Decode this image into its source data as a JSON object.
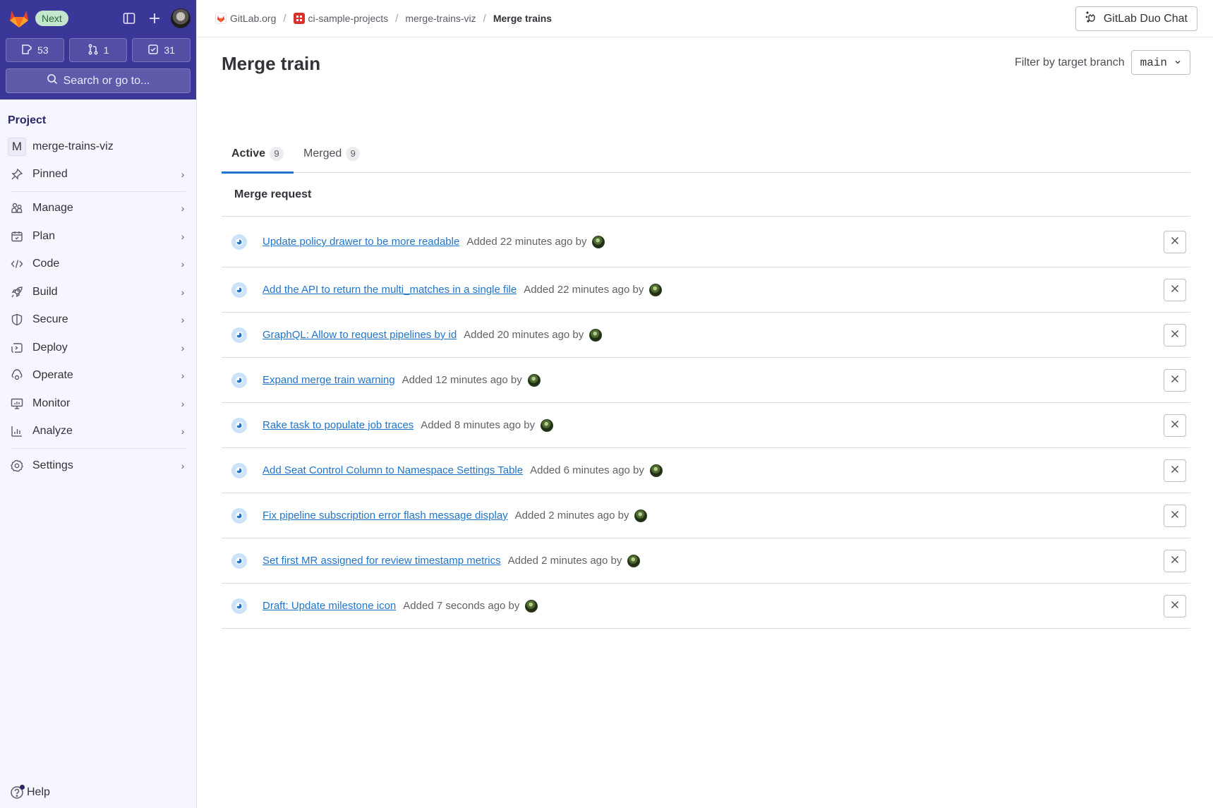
{
  "sidebar": {
    "badge": "Next",
    "counts": {
      "issues": "53",
      "merge_requests": "1",
      "todos": "31"
    },
    "search_label": "Search or go to...",
    "section_heading": "Project",
    "project": {
      "initial": "M",
      "name": "merge-trains-viz"
    },
    "items": [
      {
        "label": "Pinned",
        "icon": "pin-icon"
      },
      {
        "label": "Manage",
        "icon": "users-icon"
      },
      {
        "label": "Plan",
        "icon": "calendar-icon"
      },
      {
        "label": "Code",
        "icon": "code-icon"
      },
      {
        "label": "Build",
        "icon": "rocket-icon"
      },
      {
        "label": "Secure",
        "icon": "shield-icon"
      },
      {
        "label": "Deploy",
        "icon": "deploy-icon"
      },
      {
        "label": "Operate",
        "icon": "cloud-gear-icon"
      },
      {
        "label": "Monitor",
        "icon": "monitor-icon"
      },
      {
        "label": "Analyze",
        "icon": "chart-icon"
      },
      {
        "label": "Settings",
        "icon": "gear-icon"
      }
    ],
    "help_label": "Help"
  },
  "breadcrumb": {
    "items": [
      "GitLab.org",
      "ci-sample-projects",
      "merge-trains-viz"
    ],
    "current": "Merge trains"
  },
  "header": {
    "duo_chat_label": "GitLab Duo Chat"
  },
  "main": {
    "title": "Merge train",
    "filter_label": "Filter by target branch",
    "filter_value": "main",
    "tabs": [
      {
        "label": "Active",
        "count": "9",
        "active": true
      },
      {
        "label": "Merged",
        "count": "9",
        "active": false
      }
    ],
    "table_header": "Merge request",
    "rows": [
      {
        "title": "Update policy drawer to be more readable",
        "added": "Added 22 minutes ago by"
      },
      {
        "title": "Add the API to return the multi_matches in a single file",
        "added": "Added 22 minutes ago by"
      },
      {
        "title": "GraphQL: Allow to request pipelines by id",
        "added": "Added 20 minutes ago by"
      },
      {
        "title": "Expand merge train warning",
        "added": "Added 12 minutes ago by"
      },
      {
        "title": "Rake task to populate job traces",
        "added": "Added 8 minutes ago by"
      },
      {
        "title": "Add Seat Control Column to Namespace Settings Table",
        "added": "Added 6 minutes ago by"
      },
      {
        "title": "Fix pipeline subscription error flash message display",
        "added": "Added 2 minutes ago by"
      },
      {
        "title": "Set first MR assigned for review timestamp metrics",
        "added": "Added 2 minutes ago by"
      },
      {
        "title": "Draft: Update milestone icon",
        "added": "Added 7 seconds ago by"
      }
    ]
  },
  "colors": {
    "sidebar_top": "#3b3799",
    "link": "#1f75cb",
    "tab_active": "#1f75cb",
    "badge_bg": "#c3e6cd"
  }
}
